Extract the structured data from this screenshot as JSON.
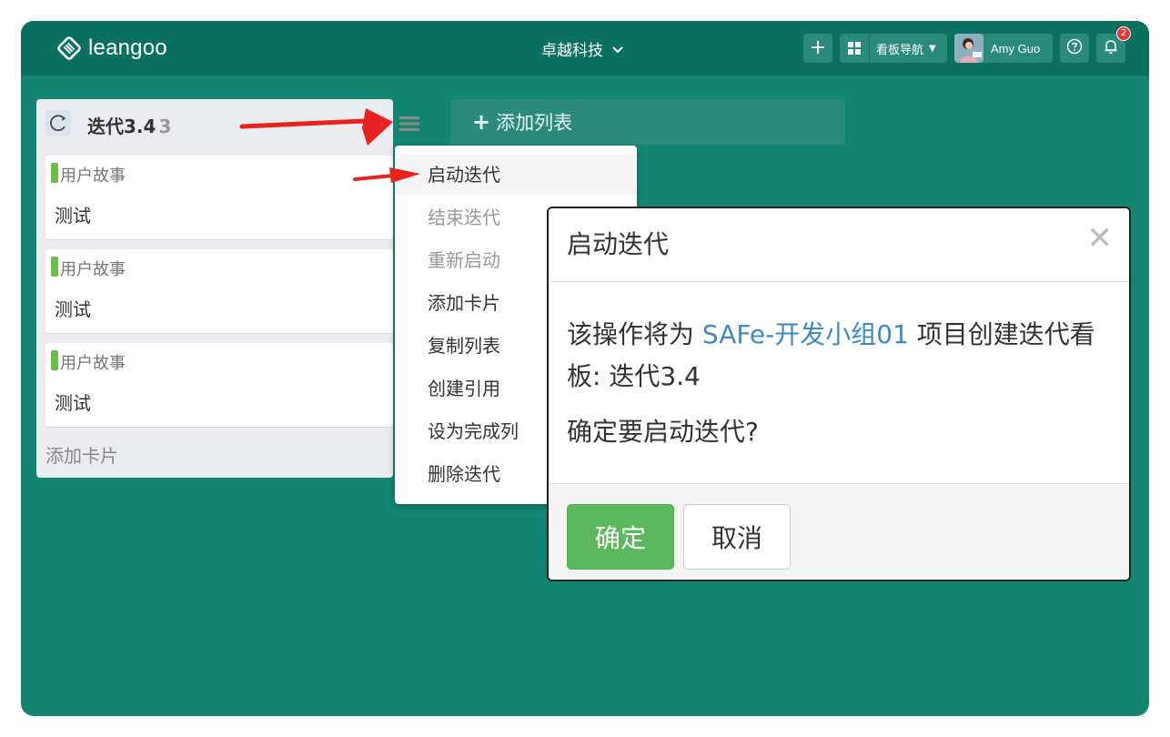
{
  "topbar": {
    "logo_text": "leangoo",
    "org_name": "卓越科技",
    "add_icon": "plus-icon",
    "board_nav_label": "看板导航",
    "user_name": "Amy Guo",
    "notification_count": "2"
  },
  "list": {
    "title": "迭代3.4",
    "count": "3",
    "cards": [
      {
        "type": "用户故事",
        "title": "测试"
      },
      {
        "type": "用户故事",
        "title": "测试"
      },
      {
        "type": "用户故事",
        "title": "测试"
      }
    ],
    "add_card": "添加卡片"
  },
  "add_list": {
    "label": "添加列表"
  },
  "menu": {
    "items": [
      {
        "label": "启动迭代"
      },
      {
        "label": "结束迭代"
      },
      {
        "label": "重新启动"
      },
      {
        "label": "添加卡片"
      },
      {
        "label": "复制列表"
      },
      {
        "label": "创建引用"
      },
      {
        "label": "设为完成列"
      },
      {
        "label": "删除迭代"
      }
    ]
  },
  "dialog": {
    "title": "启动迭代",
    "body_prefix": "该操作将为 ",
    "project": "SAFe-开发小组01",
    "body_suffix": " 项目创建迭代看板: 迭代3.4",
    "confirm_question": "确定要启动迭代?",
    "ok_label": "确定",
    "cancel_label": "取消"
  },
  "colors": {
    "app_bg": "#148572",
    "topbar_bg": "#0c7060",
    "accent_green": "#5cb85c",
    "link_blue": "#3a89c9",
    "annotation_red": "#e8231f"
  }
}
